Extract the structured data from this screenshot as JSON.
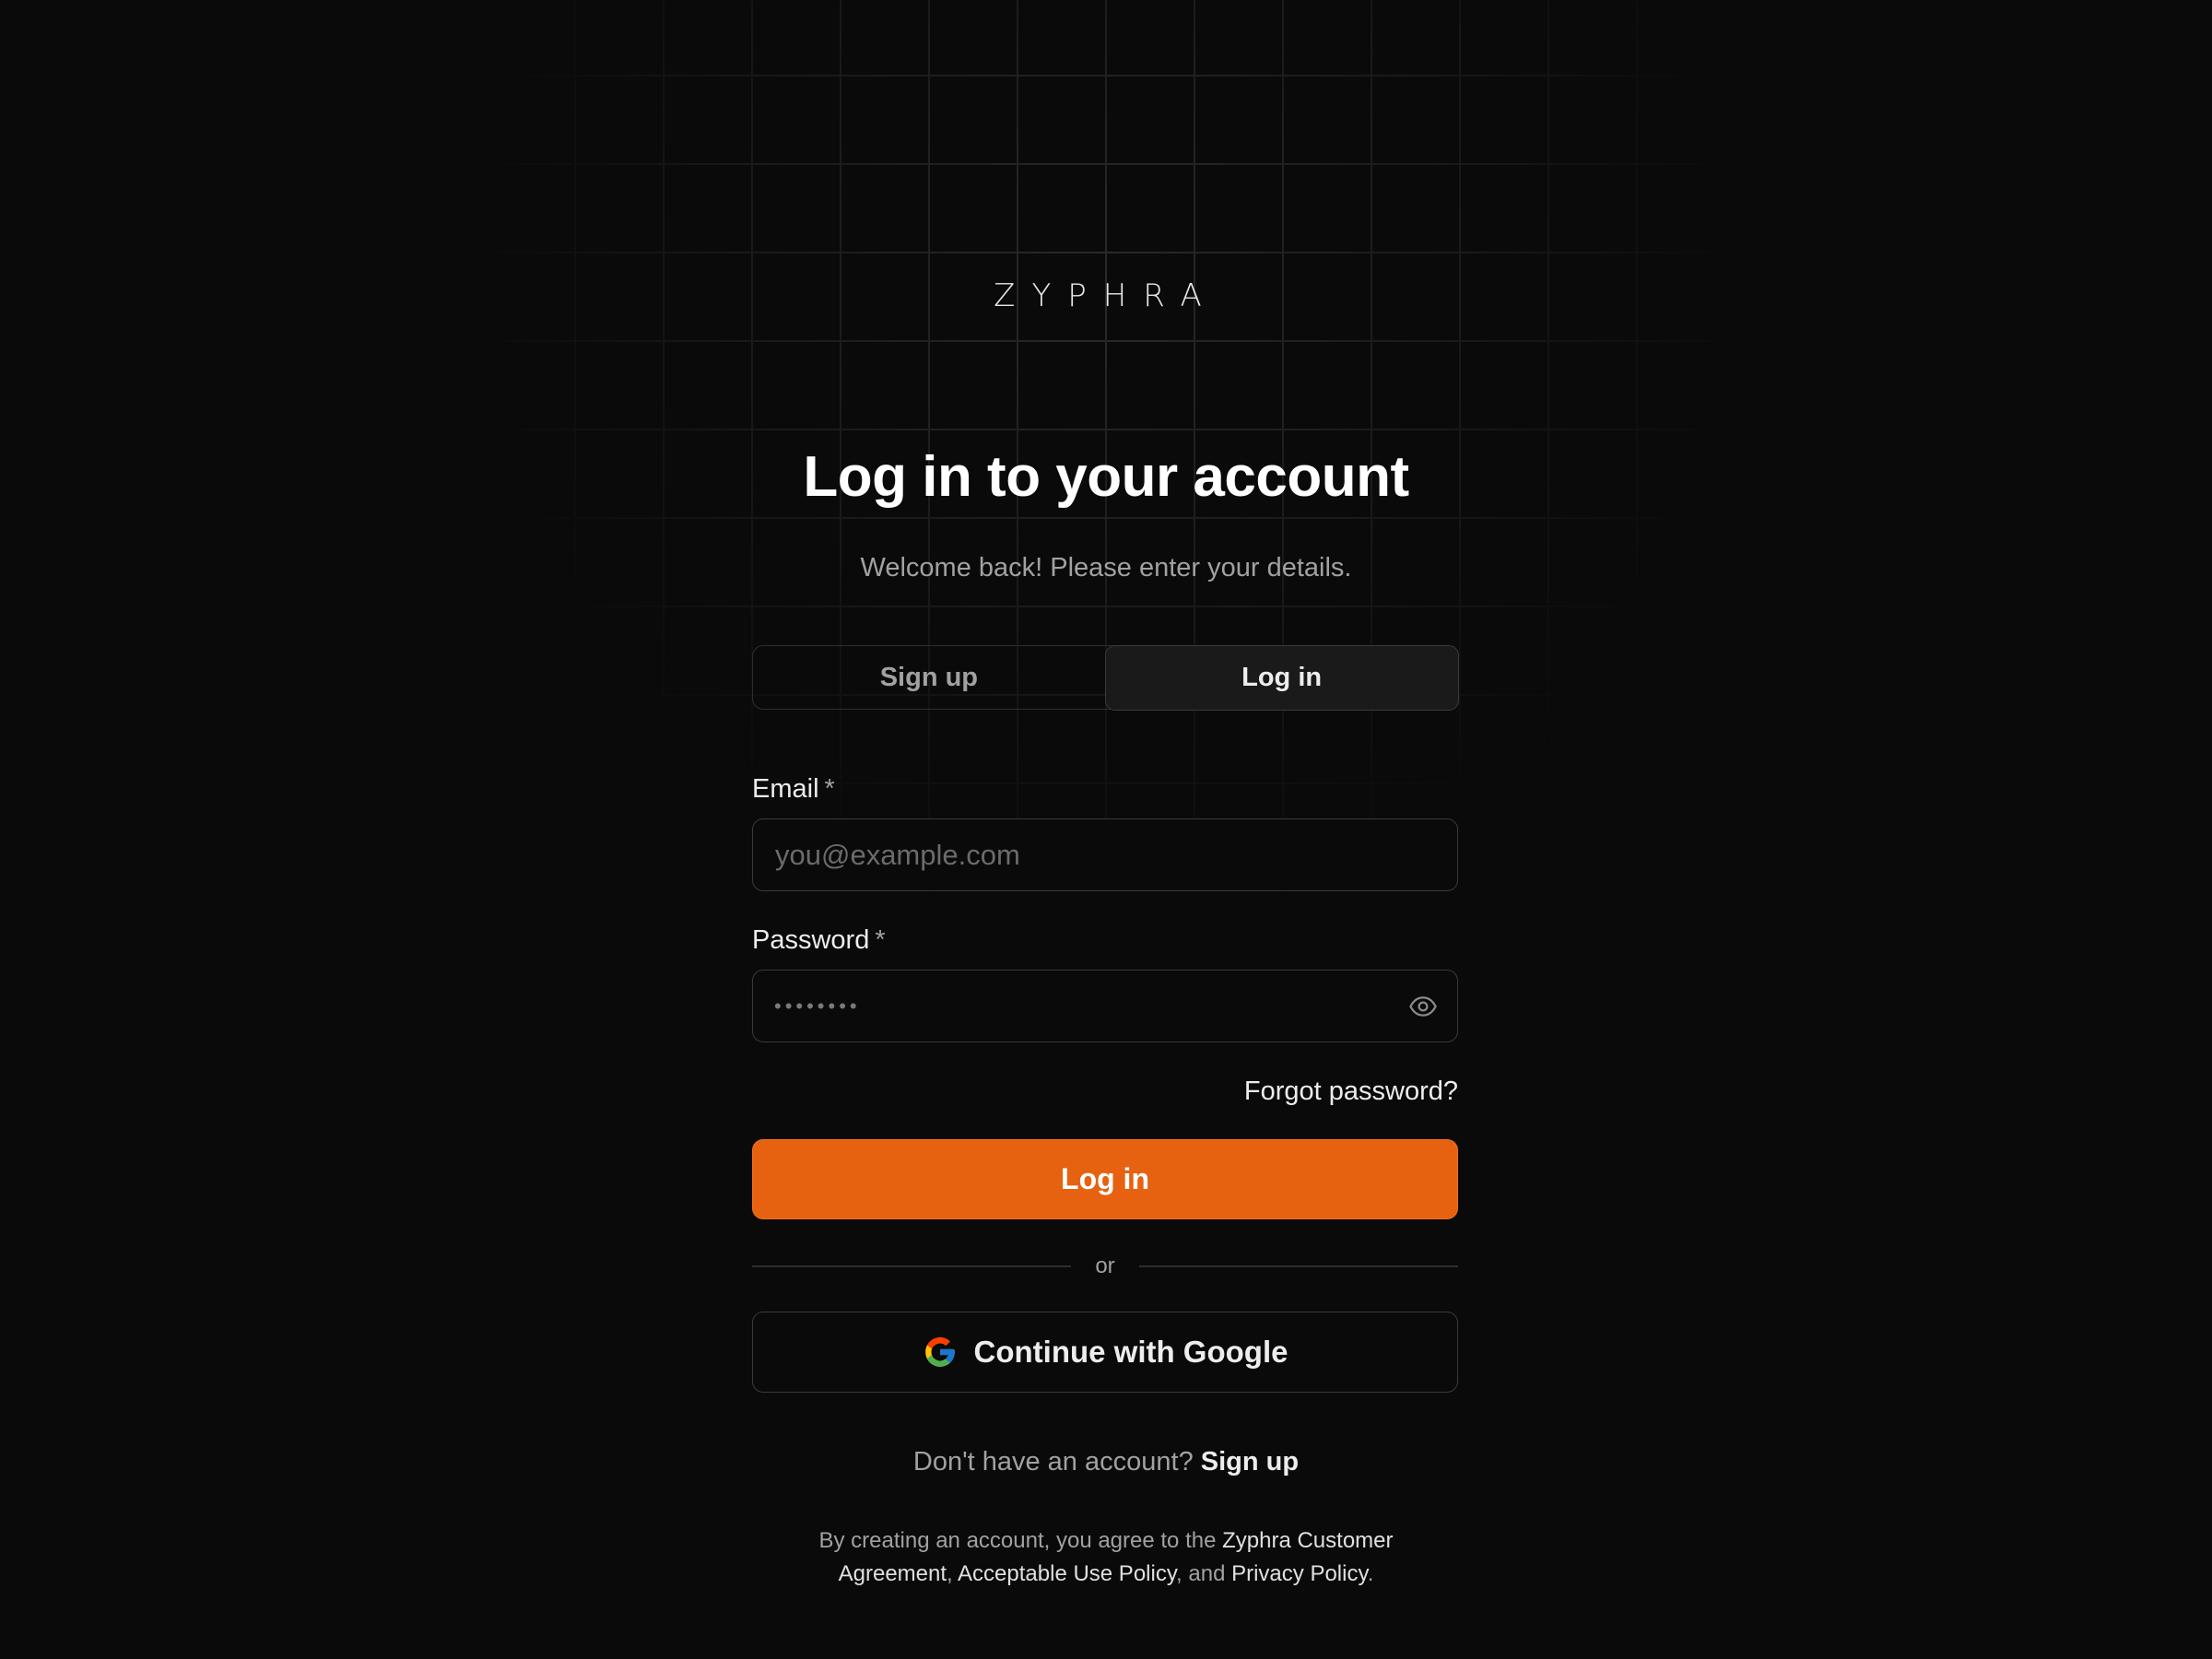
{
  "brand": {
    "logo_text": "ZYPHRA"
  },
  "header": {
    "title": "Log in to your account",
    "subtitle": "Welcome back! Please enter your details."
  },
  "tabs": [
    {
      "label": "Sign up",
      "active": false
    },
    {
      "label": "Log in",
      "active": true
    }
  ],
  "form": {
    "email": {
      "label": "Email",
      "required_mark": "*",
      "placeholder": "you@example.com",
      "value": ""
    },
    "password": {
      "label": "Password",
      "required_mark": "*",
      "masked_value": "••••••••",
      "toggle_icon": "eye-icon"
    },
    "forgot_label": "Forgot password?",
    "submit_label": "Log in"
  },
  "divider_text": "or",
  "google_button": {
    "label": "Continue with Google",
    "icon": "google-icon"
  },
  "signup_prompt": {
    "text": "Don't have an account?",
    "link": "Sign up"
  },
  "legal": {
    "prefix": "By creating an account, you agree to the ",
    "link1": "Zyphra Customer Agreement",
    "sep1": ", ",
    "link2": "Acceptable Use Policy",
    "sep2": ", and ",
    "link3": "Privacy Policy",
    "suffix": "."
  },
  "colors": {
    "background": "#0a0a0a",
    "accent": "#e66210",
    "text": "#ededed",
    "muted": "#a1a1a1",
    "border": "#3a3a3a"
  }
}
